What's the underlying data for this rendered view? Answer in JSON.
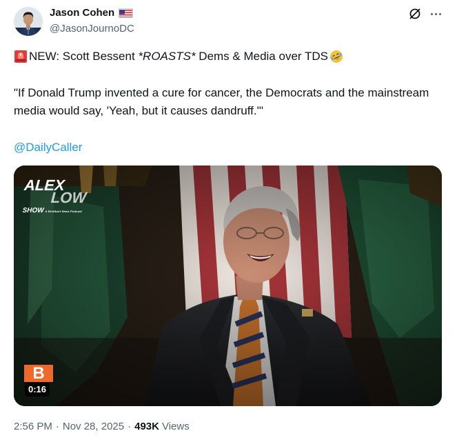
{
  "author": {
    "name": "Jason Cohen",
    "handle": "@JasonJournoDC",
    "flag_icon": "us-flag-icon"
  },
  "tweet": {
    "line1_prefix": "NEW: Scott Bessent ",
    "line1_italic": "*ROASTS*",
    "line1_suffix": " Dems & Media over TDS",
    "quote": "\"If Donald Trump invented a cure for cancer, the Democrats and the mainstream media would say, 'Yeah, but it causes dandruff.'\"",
    "mention": "@DailyCaller",
    "siren_icon": "rotating-light-icon",
    "emoji_icon": "rolling-on-floor-laughing-icon"
  },
  "media": {
    "logo_line1": "ALEX",
    "logo_line2": "LOW",
    "logo_show": "SHOW",
    "logo_tagline": "A Breitbart News Podcast",
    "brand_mark": "B",
    "duration": "0:16"
  },
  "meta": {
    "time": "2:56 PM",
    "separator": "·",
    "date": "Nov 28, 2025",
    "views_count": "493K",
    "views_label": "Views"
  },
  "colors": {
    "link": "#1d9bf0",
    "secondary_text": "#536471",
    "brand_orange": "#ef6a2a"
  }
}
